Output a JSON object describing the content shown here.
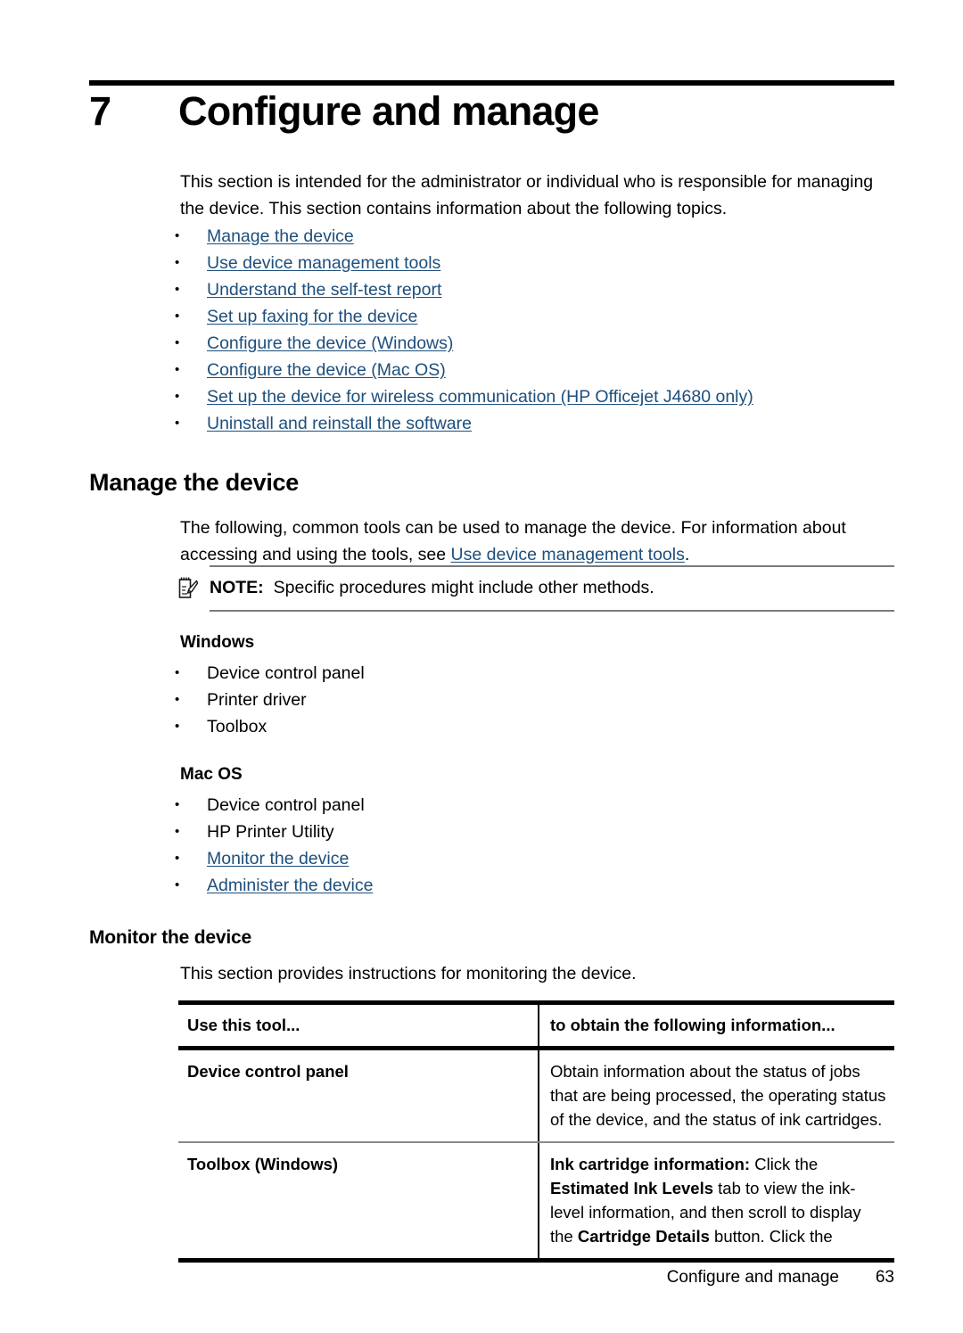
{
  "chapter": {
    "number": "7",
    "title": "Configure and manage"
  },
  "intro": {
    "paragraph": "This section is intended for the administrator or individual who is responsible for managing the device. This section contains information about the following topics."
  },
  "topic_links": [
    "Manage the device",
    "Use device management tools",
    "Understand the self-test report",
    "Set up faxing for the device",
    "Configure the device (Windows)",
    "Configure the device (Mac OS)",
    "Set up the device for wireless communication (HP Officejet J4680 only)",
    "Uninstall and reinstall the software"
  ],
  "manage_section": {
    "heading": "Manage the device",
    "paragraph_before_link": "The following, common tools can be used to manage the device. For information about accessing and using the tools, see ",
    "inline_link": "Use device management tools",
    "paragraph_after_link": ".",
    "note": {
      "icon": "note-pad-pencil-icon",
      "label": "NOTE:",
      "text": "Specific procedures might include other methods."
    },
    "windows": {
      "heading": "Windows",
      "items": [
        "Device control panel",
        "Printer driver",
        "Toolbox"
      ]
    },
    "macos": {
      "heading": "Mac OS",
      "items": [
        {
          "text": "Device control panel",
          "is_link": false
        },
        {
          "text": "HP Printer Utility",
          "is_link": false
        },
        {
          "text": "Monitor the device",
          "is_link": true
        },
        {
          "text": "Administer the device",
          "is_link": true
        }
      ]
    }
  },
  "monitor_section": {
    "heading": "Monitor the device",
    "paragraph": "This section provides instructions for monitoring the device.",
    "table": {
      "headers": [
        "Use this tool...",
        "to obtain the following information..."
      ],
      "rows": [
        {
          "tool": "Device control panel",
          "info_runs": [
            {
              "text": "Obtain information about the status of jobs that are being processed, the operating status of the device, and the status of ink cartridges.",
              "bold": false
            }
          ]
        },
        {
          "tool": "Toolbox (Windows)",
          "info_runs": [
            {
              "text": "Ink cartridge information:",
              "bold": true
            },
            {
              "text": " Click the ",
              "bold": false
            },
            {
              "text": "Estimated Ink Levels",
              "bold": true
            },
            {
              "text": " tab to view the ink-level information, and then scroll to display the ",
              "bold": false
            },
            {
              "text": "Cartridge Details",
              "bold": true
            },
            {
              "text": " button. Click the",
              "bold": false
            }
          ]
        }
      ]
    }
  },
  "footer": {
    "title": "Configure and manage",
    "page_number": "63"
  },
  "colors": {
    "link": "#1d4f7c",
    "rule": "#000000",
    "thin_rule": "#8a8a8a",
    "text": "#000000"
  }
}
